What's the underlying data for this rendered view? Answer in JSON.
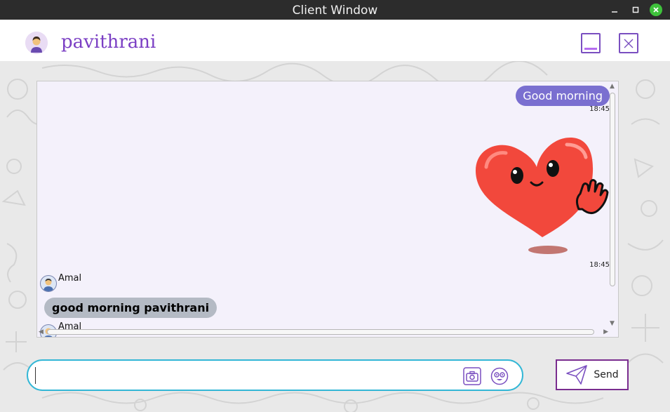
{
  "window": {
    "title": "Client Window"
  },
  "header": {
    "username": "pavithrani"
  },
  "chat": {
    "messages": [
      {
        "direction": "out",
        "text": "Good morning",
        "time": "18:45"
      },
      {
        "direction": "out",
        "type": "sticker",
        "sticker_icon": "waving-heart-sticker",
        "time": "18:45"
      },
      {
        "direction": "in",
        "sender": "Amal",
        "text": "good morning pavithrani"
      },
      {
        "direction": "in",
        "sender": "Amal"
      }
    ]
  },
  "composer": {
    "value": "",
    "placeholder": ""
  },
  "send": {
    "label": "Send"
  },
  "colors": {
    "accent": "#7b3fc4",
    "outgoing_bubble": "#7a6fd0",
    "incoming_bubble": "#b4bac4",
    "input_border": "#33b7d6",
    "send_border": "#7a2d8f"
  }
}
